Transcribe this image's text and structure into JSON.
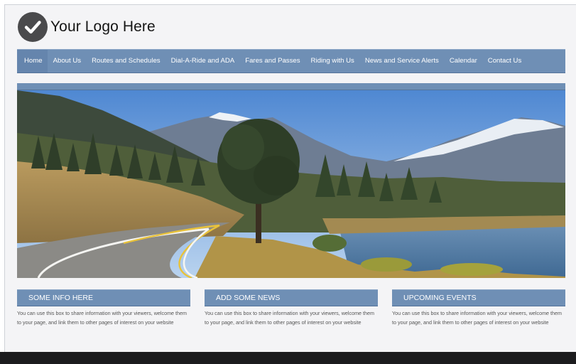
{
  "logo": {
    "text": "Your Logo Here",
    "icon": "checkmark-circle-icon"
  },
  "nav": {
    "items": [
      {
        "label": "Home",
        "active": true
      },
      {
        "label": "About Us"
      },
      {
        "label": "Routes and Schedules"
      },
      {
        "label": "Dial-A-Ride and ADA"
      },
      {
        "label": "Fares and Passes"
      },
      {
        "label": "Riding with Us"
      },
      {
        "label": "News and Service Alerts"
      },
      {
        "label": "Calendar"
      },
      {
        "label": "Contact Us"
      }
    ]
  },
  "boxes": [
    {
      "title": "SOME INFO HERE",
      "text": "You can use this box to share information with your viewers, welcome them to your page, and link them to other pages of interest on your website"
    },
    {
      "title": "ADD SOME NEWS",
      "text": "You can use this box to share information with your viewers, welcome them to your page, and link them to other pages of interest on your website"
    },
    {
      "title": "UPCOMING EVENTS",
      "text": "You can use this box to share information with your viewers, welcome them to your page, and link them to other pages of interest on your website"
    }
  ],
  "colors": {
    "accent": "#6f8fb5",
    "footer": "#1c1c1e",
    "background": "#f4f4f6"
  }
}
